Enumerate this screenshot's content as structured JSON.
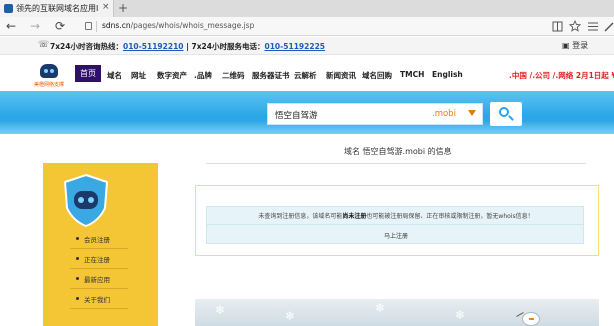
{
  "browser": {
    "tab_title": "领先的互联网域名应用I",
    "tab_close": "×",
    "new_tab": "+",
    "back": "←",
    "forward": "→",
    "refresh": "⟳",
    "url_domain": "sdns.cn",
    "url_path": "/pages/whois/whois_message.jsp",
    "icons": {
      "reader": "book-icon",
      "favorite": "star-icon",
      "hub": "hub-icon",
      "notes": "pen-icon"
    }
  },
  "hotline": {
    "text1": "7x24小时咨询热线：",
    "phone1": "010-51192210",
    "divider": " | ",
    "text2": "7x24小时服务电话：",
    "phone2": "010-51192225",
    "login_label": "登录"
  },
  "nav": {
    "logo_text": "美橙网络支撑",
    "home": "首页",
    "items": [
      "域名",
      "网址",
      "数字资产",
      ".品牌",
      "二维码",
      "服务器证书",
      "云解析",
      "新闻资讯",
      "域名回购",
      "TMCH",
      "English"
    ],
    "promo": ".中国 /.公司 /.网络  2月1日起 ¥"
  },
  "search": {
    "value": "悟空自驾游",
    "suffix": ".mobi",
    "button_icon": "search-icon"
  },
  "sidebar": {
    "items": [
      "会员注册",
      "正在注册",
      "最新应用",
      "关于我们"
    ]
  },
  "content": {
    "info_title": "域名 悟空自驾游.mobi 的信息",
    "msg_part1": "未查询到注册信息，该域名可能",
    "msg_bold": "尚未注册",
    "msg_part2": "也可能被注册局保留、正在审核或限制注册，暂无whois信息！",
    "register": "马上注册"
  },
  "colors": {
    "accent_blue": "#2aa5e6",
    "home_nav": "#2e1065",
    "sidebar_yellow": "#f4c534",
    "promo_red": "#e02020",
    "suffix_orange": "#e57c10"
  }
}
